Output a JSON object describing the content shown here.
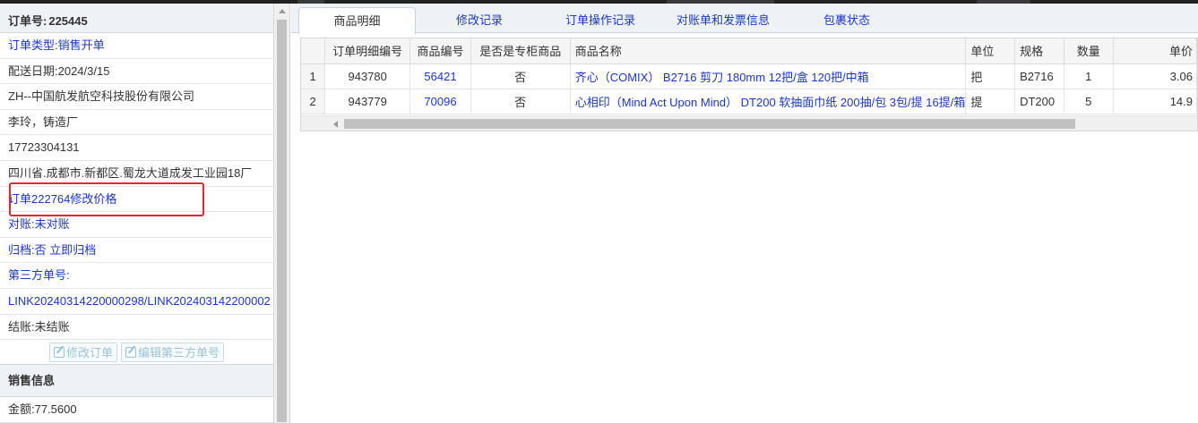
{
  "order": {
    "title_label": "订单号:",
    "title_value": "225445",
    "type_label": "订单类型:",
    "type_value": "销售开单",
    "delivery": "配送日期:2024/3/15",
    "company": "ZH--中国航发航空科技股份有限公司",
    "contact": "李玲，铸造厂",
    "phone": "17723304131",
    "address": "四川省.成都市.新都区.蜀龙大道成发工业园18厂",
    "note": "订单222764修改价格",
    "reconcile_label": "对账:",
    "reconcile_value": "未对账",
    "archive_label": "归档:",
    "archive_value": "否 立即归档",
    "third_party_label": "第三方单号:",
    "third_party_value": "LINK20240314220000298/LINK202403142200002",
    "settle": "结账:未结账",
    "edit_order_btn": "修改订单",
    "edit_third_btn": "编辑第三方单号"
  },
  "sales": {
    "section_title": "销售信息",
    "amount": "金额:77.5600"
  },
  "tabs": [
    "商品明细",
    "修改记录",
    "订单操作记录",
    "对账单和发票信息",
    "包裹状态"
  ],
  "table": {
    "headers": [
      "订单明细编号",
      "商品编号",
      "是否是专柜商品",
      "商品名称",
      "单位",
      "规格",
      "数量",
      "单价"
    ],
    "rows": [
      {
        "rn": "1",
        "detail_id": "943780",
        "product_id": "56421",
        "counter": "否",
        "name": "齐心（COMIX） B2716 剪刀 180mm 12把/盒 120把/中箱",
        "unit": "把",
        "spec": "B2716",
        "qty": "1",
        "price": "3.06"
      },
      {
        "rn": "2",
        "detail_id": "943779",
        "product_id": "70096",
        "counter": "否",
        "name": "心相印（Mind Act Upon Mind） DT200 软抽面巾纸 200抽/包 3包/提 16提/箱",
        "unit": "提",
        "spec": "DT200",
        "qty": "5",
        "price": "14.9"
      }
    ]
  },
  "colors": {
    "link": "#1c37c8",
    "highlight": "#e0282e",
    "header_bg": "#eef2f6"
  }
}
